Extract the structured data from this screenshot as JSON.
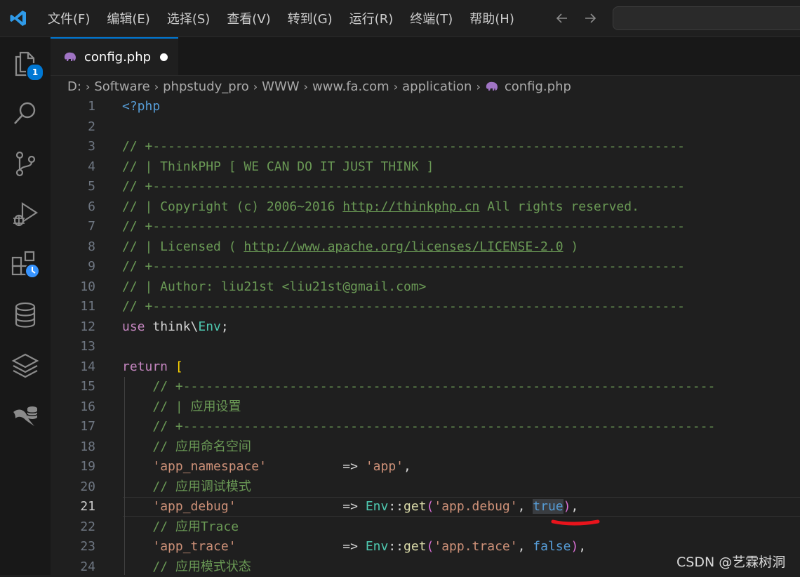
{
  "menu": [
    "文件(F)",
    "编辑(E)",
    "选择(S)",
    "查看(V)",
    "转到(G)",
    "运行(R)",
    "终端(T)",
    "帮助(H)"
  ],
  "nav": {
    "back": "←",
    "forward": "→"
  },
  "activity": {
    "explorer_badge": "1",
    "icons": [
      "files-icon",
      "search-icon",
      "source-control-icon",
      "run-debug-icon",
      "extensions-icon",
      "database-icon",
      "layers-icon",
      "mysql-icon"
    ]
  },
  "tab": {
    "label": "config.php",
    "dirty": true
  },
  "breadcrumb": [
    "D:",
    "Software",
    "phpstudy_pro",
    "WWW",
    "www.fa.com",
    "application",
    "config.php"
  ],
  "active_line": 21,
  "lines": [
    {
      "n": "1",
      "tokens": [
        [
          "tag",
          "<?php"
        ]
      ]
    },
    {
      "n": "2",
      "tokens": []
    },
    {
      "n": "3",
      "tokens": [
        [
          "comment",
          "// +----------------------------------------------------------------------"
        ]
      ]
    },
    {
      "n": "4",
      "tokens": [
        [
          "comment",
          "// | ThinkPHP [ WE CAN DO IT JUST THINK ]"
        ]
      ]
    },
    {
      "n": "5",
      "tokens": [
        [
          "comment",
          "// +----------------------------------------------------------------------"
        ]
      ]
    },
    {
      "n": "6",
      "tokens": [
        [
          "comment",
          "// | Copyright (c) 2006~2016 "
        ],
        [
          "link",
          "http://thinkphp.cn"
        ],
        [
          "comment",
          " All rights reserved."
        ]
      ]
    },
    {
      "n": "7",
      "tokens": [
        [
          "comment",
          "// +----------------------------------------------------------------------"
        ]
      ]
    },
    {
      "n": "8",
      "tokens": [
        [
          "comment",
          "// | Licensed ( "
        ],
        [
          "link",
          "http://www.apache.org/licenses/LICENSE-2.0"
        ],
        [
          "comment",
          " )"
        ]
      ]
    },
    {
      "n": "9",
      "tokens": [
        [
          "comment",
          "// +----------------------------------------------------------------------"
        ]
      ]
    },
    {
      "n": "10",
      "tokens": [
        [
          "comment",
          "// | Author: liu21st <liu21st@gmail.com>"
        ]
      ]
    },
    {
      "n": "11",
      "tokens": [
        [
          "comment",
          "// +----------------------------------------------------------------------"
        ]
      ]
    },
    {
      "n": "12",
      "tokens": [
        [
          "keyword",
          "use"
        ],
        [
          "plain",
          " think\\"
        ],
        [
          "class",
          "Env"
        ],
        [
          "plain",
          ";"
        ]
      ]
    },
    {
      "n": "13",
      "tokens": []
    },
    {
      "n": "14",
      "tokens": [
        [
          "keyword",
          "return"
        ],
        [
          "plain",
          " "
        ],
        [
          "bracket",
          "["
        ]
      ]
    },
    {
      "n": "15",
      "tokens": [
        [
          "plain",
          "    "
        ],
        [
          "comment",
          "// +----------------------------------------------------------------------"
        ]
      ]
    },
    {
      "n": "16",
      "tokens": [
        [
          "plain",
          "    "
        ],
        [
          "comment",
          "// | 应用设置"
        ]
      ]
    },
    {
      "n": "17",
      "tokens": [
        [
          "plain",
          "    "
        ],
        [
          "comment",
          "// +----------------------------------------------------------------------"
        ]
      ]
    },
    {
      "n": "18",
      "tokens": [
        [
          "plain",
          "    "
        ],
        [
          "comment",
          "// 应用命名空间"
        ]
      ]
    },
    {
      "n": "19",
      "tokens": [
        [
          "plain",
          "    "
        ],
        [
          "string",
          "'app_namespace'"
        ],
        [
          "plain",
          "          => "
        ],
        [
          "string",
          "'app'"
        ],
        [
          "plain",
          ","
        ]
      ]
    },
    {
      "n": "20",
      "tokens": [
        [
          "plain",
          "    "
        ],
        [
          "comment",
          "// 应用调试模式"
        ]
      ]
    },
    {
      "n": "21",
      "tokens": [
        [
          "plain",
          "    "
        ],
        [
          "string",
          "'app_debug'"
        ],
        [
          "plain",
          "              => "
        ],
        [
          "class",
          "Env"
        ],
        [
          "plain",
          "::"
        ],
        [
          "func",
          "get"
        ],
        [
          "paren",
          "("
        ],
        [
          "string",
          "'app.debug'"
        ],
        [
          "plain",
          ", "
        ],
        [
          "constsel",
          "true"
        ],
        [
          "paren",
          ")"
        ],
        [
          "plain",
          ","
        ]
      ]
    },
    {
      "n": "22",
      "tokens": [
        [
          "plain",
          "    "
        ],
        [
          "comment",
          "// 应用Trace"
        ]
      ]
    },
    {
      "n": "23",
      "tokens": [
        [
          "plain",
          "    "
        ],
        [
          "string",
          "'app_trace'"
        ],
        [
          "plain",
          "              => "
        ],
        [
          "class",
          "Env"
        ],
        [
          "plain",
          "::"
        ],
        [
          "func",
          "get"
        ],
        [
          "paren",
          "("
        ],
        [
          "string",
          "'app.trace'"
        ],
        [
          "plain",
          ", "
        ],
        [
          "const",
          "false"
        ],
        [
          "paren",
          ")"
        ],
        [
          "plain",
          ","
        ]
      ]
    },
    {
      "n": "24",
      "tokens": [
        [
          "plain",
          "    "
        ],
        [
          "comment",
          "// 应用模式状态"
        ]
      ]
    }
  ],
  "watermark": "CSDN @艺霖树洞"
}
